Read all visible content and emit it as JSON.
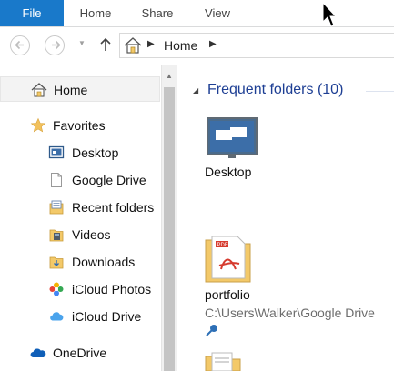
{
  "ribbon": {
    "tabs": [
      {
        "label": "File"
      },
      {
        "label": "Home"
      },
      {
        "label": "Share"
      },
      {
        "label": "View"
      }
    ]
  },
  "address": {
    "current": "Home"
  },
  "nav": {
    "items": [
      {
        "label": "Home",
        "icon": "home-icon"
      },
      {
        "label": "Favorites",
        "icon": "star-icon"
      },
      {
        "label": "Desktop",
        "icon": "desktop-icon"
      },
      {
        "label": "Google Drive",
        "icon": "document-icon"
      },
      {
        "label": "Recent folders",
        "icon": "recent-folders-icon"
      },
      {
        "label": "Videos",
        "icon": "videos-icon"
      },
      {
        "label": "Downloads",
        "icon": "downloads-icon"
      },
      {
        "label": "iCloud Photos",
        "icon": "icloud-photos-icon"
      },
      {
        "label": "iCloud Drive",
        "icon": "icloud-drive-icon"
      },
      {
        "label": "OneDrive",
        "icon": "onedrive-icon"
      }
    ]
  },
  "content": {
    "group_title": "Frequent folders (10)",
    "folders": [
      {
        "name": "Desktop",
        "path": ""
      },
      {
        "name": "portfolio",
        "path": "C:\\Users\\Walker\\Google Drive"
      }
    ]
  },
  "colors": {
    "accent": "#1979ca",
    "group_title": "#1e3f94",
    "folder": "#f3c969"
  }
}
